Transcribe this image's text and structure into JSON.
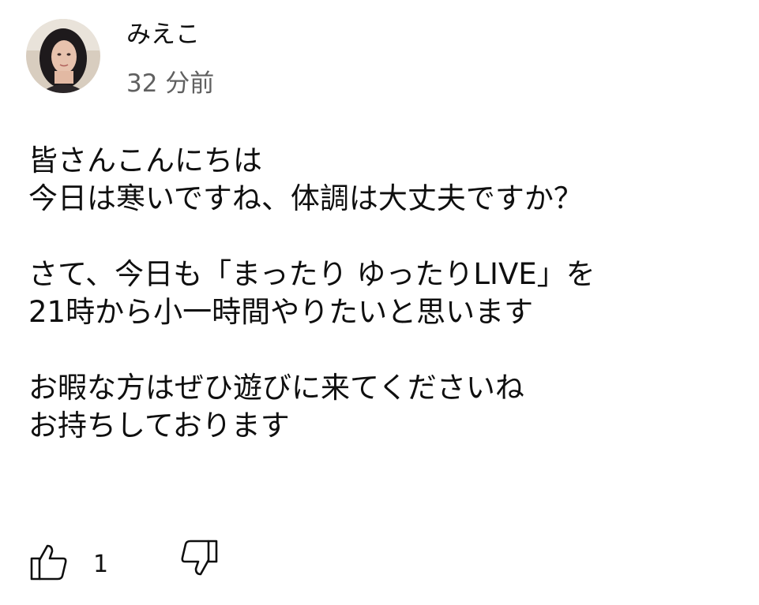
{
  "comment": {
    "author": "みえこ",
    "timestamp": "32 分前",
    "body_lines": [
      "皆さんこんにちは",
      "今日は寒いですね、体調は大丈夫ですか？",
      "",
      "さて、今日も「まったり ゆったりLIVE」を",
      "21時から小一時間やりたいと思います",
      "",
      "お暇な方はぜひ遊びに来てくださいね",
      "お持ちしております"
    ],
    "like_count": "1"
  },
  "icons": {
    "avatar": "user-avatar",
    "like": "thumbs-up-icon",
    "dislike": "thumbs-down-icon"
  },
  "colors": {
    "text_primary": "#0f0f0f",
    "text_secondary": "#606060",
    "background": "#ffffff"
  }
}
